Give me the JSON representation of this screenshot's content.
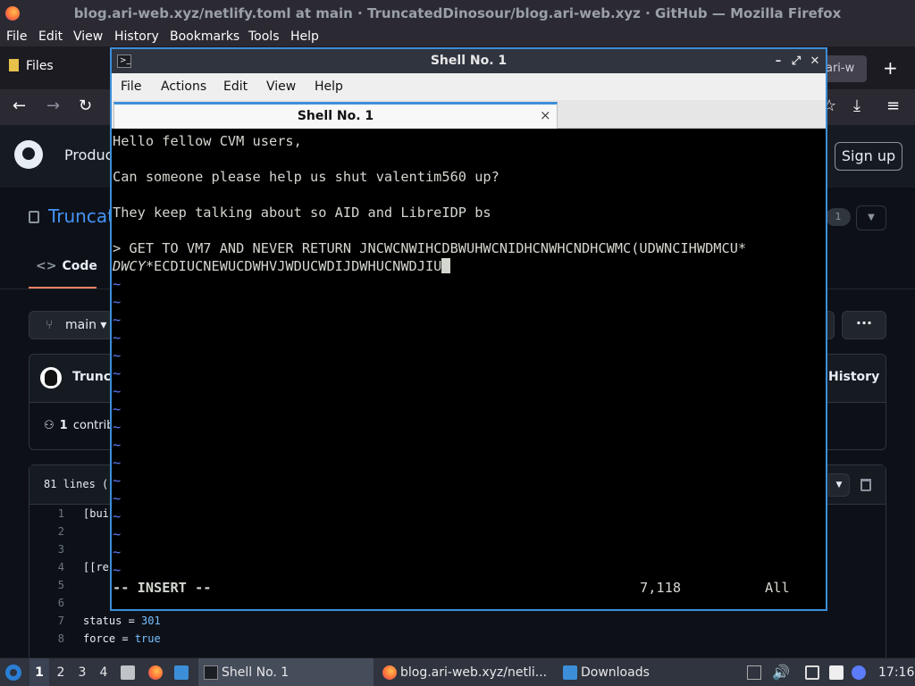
{
  "firefox": {
    "window_title": "blog.ari-web.xyz/netlify.toml at main · TruncatedDinosour/blog.ari-web.xyz · GitHub — Mozilla Firefox",
    "menu": [
      "File",
      "Edit",
      "View",
      "History",
      "Bookmarks",
      "Tools",
      "Help"
    ],
    "tabs": {
      "files_label": "Files",
      "partial_tab": "ari-w",
      "new_tab": "+"
    },
    "nav_icons": [
      "back-icon",
      "forward-icon",
      "reload-icon",
      "bookmark-icon",
      "download-icon",
      "menu-icon"
    ]
  },
  "github": {
    "product_partial": "Produc",
    "sign_up": "Sign up",
    "repo_partial": "Truncat",
    "count_badge": "1",
    "code_tab": "Code",
    "branch": "main",
    "more": "···",
    "commit_author_partial": "Trunca",
    "history": "History",
    "contributors_count": "1",
    "contributors_partial": "contrib",
    "file_lines_partial": "81 lines (",
    "code_lines": [
      {
        "n": "1",
        "text": "[bui"
      },
      {
        "n": "2",
        "text": ""
      },
      {
        "n": "3",
        "text": ""
      },
      {
        "n": "4",
        "text": "[[re"
      },
      {
        "n": "5",
        "text": ""
      },
      {
        "n": "6",
        "text": ""
      },
      {
        "n": "7",
        "key": "status",
        "op": " = ",
        "val": "301"
      },
      {
        "n": "8",
        "key": "force",
        "op": " = ",
        "val": "true"
      }
    ]
  },
  "terminal": {
    "title": "Shell No. 1",
    "menu": [
      "File",
      "Actions",
      "Edit",
      "View",
      "Help"
    ],
    "tab_label": "Shell No. 1",
    "tab_close": "×",
    "lines": [
      "Hello fellow CVM users,",
      "",
      "Can someone please help us shut valentim560 up?",
      "",
      "They keep talking about so AID and LibreIDP bs",
      "",
      "> GET TO VM7 AND NEVER RETURN JNCWCNWIHCDBWUHWCNIDHCNWHCNDHCWMC(UDWNCIHWDMCU*"
    ],
    "wrap_line_italic": "DWCY",
    "wrap_line_rest": "*ECDIUCNEWUCDWHVJWDUCWDIJDWHUCNWDJIU",
    "tilde": "~",
    "status_mode": "-- INSERT --",
    "status_pos": "7,118",
    "status_scroll": "All"
  },
  "taskbar": {
    "workspaces": [
      "1",
      "2",
      "3",
      "4"
    ],
    "tasks": [
      {
        "label": "Shell No. 1"
      },
      {
        "label": "blog.ari-web.xyz/netli..."
      },
      {
        "label": "Downloads"
      }
    ],
    "clock": "17:16"
  },
  "colors": {
    "accent": "#3d8ed8",
    "terminal_bg": "#000000",
    "tilde": "#5c7cfa",
    "github_bg": "#0d1117",
    "github_link": "#4493f8",
    "firefox_chrome": "#2b2a33"
  }
}
